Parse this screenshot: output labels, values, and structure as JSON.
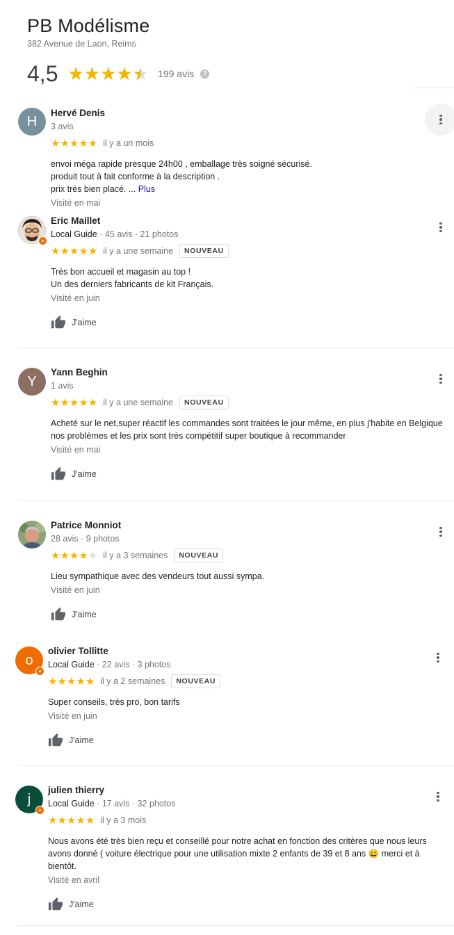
{
  "business": {
    "name": "PB Modélisme",
    "address": "382 Avenue de Laon, Reims",
    "rating": "4,5",
    "rating_value": 4.5,
    "review_count": "199 avis"
  },
  "labels": {
    "like": "J'aime",
    "new_badge": "NOUVEAU",
    "more": "Plus"
  },
  "reviews": [
    {
      "name": "Hervé Denis",
      "initial": "H",
      "avatar_color": "#78909c",
      "local_guide": "",
      "meta": "3 avis",
      "stars": 5,
      "date": "il y a un mois",
      "new": false,
      "text": [
        "envoi méga rapide presque  24h00 , emballage très soigné sécurisé.",
        "produit tout à fait conforme à la description .",
        "prix très bien placé. ..."
      ],
      "visited": "Visité en mai"
    },
    {
      "name": "Eric Maillet",
      "initial": "",
      "avatar_color": "#4a3a2a",
      "local_guide": "Local Guide",
      "meta": " · 45 avis · 21 photos",
      "stars": 5,
      "date": "il y a une semaine",
      "new": true,
      "text": [
        "Très bon accueil et magasin au top !",
        "Un des derniers fabricants de kit Français."
      ],
      "visited": "Visité en juin"
    },
    {
      "name": "Yann Beghin",
      "initial": "Y",
      "avatar_color": "#8d6e63",
      "local_guide": "",
      "meta": "1 avis",
      "stars": 5,
      "date": "il y a une semaine",
      "new": true,
      "text": [
        "Acheté sur le net,super réactif les commandes sont traitées le jour même, en plus j'habite en Belgique",
        "nos problèmes et les prix sont très compétitif super boutique à recommander"
      ],
      "visited": "Visité en mai"
    },
    {
      "name": "Patrice Monniot",
      "initial": "",
      "avatar_color": "#7a8a6a",
      "local_guide": "",
      "meta": "28 avis · 9 photos",
      "stars": 4,
      "date": "il y a 3 semaines",
      "new": true,
      "text": [
        "Lieu sympathique avec des vendeurs tout aussi sympa."
      ],
      "visited": "Visité en juin"
    },
    {
      "name": "olivier Tollitte",
      "initial": "o",
      "avatar_color": "#ef6c00",
      "local_guide": "Local Guide",
      "meta": " · 22 avis · 3 photos",
      "stars": 5,
      "date": "il y a 2 semaines",
      "new": true,
      "text": [
        "Super conseils, très pro, bon tarifs"
      ],
      "visited": "Visité en juin"
    },
    {
      "name": "julien thierry",
      "initial": "j",
      "avatar_color": "#0b4d3b",
      "local_guide": "Local Guide",
      "meta": " · 17 avis · 32 photos",
      "stars": 5,
      "date": "il y a 3 mois",
      "new": false,
      "text": [
        "Nous avons été très bien reçu et conseillé pour notre achat en fonction des critères que nous leurs",
        "avons donné ( voiture électrique pour une utilisation mixte 2 enfants de 39 et 8 ans 😀 merci et à",
        "bientôt."
      ],
      "visited": "Visité en avril"
    }
  ]
}
